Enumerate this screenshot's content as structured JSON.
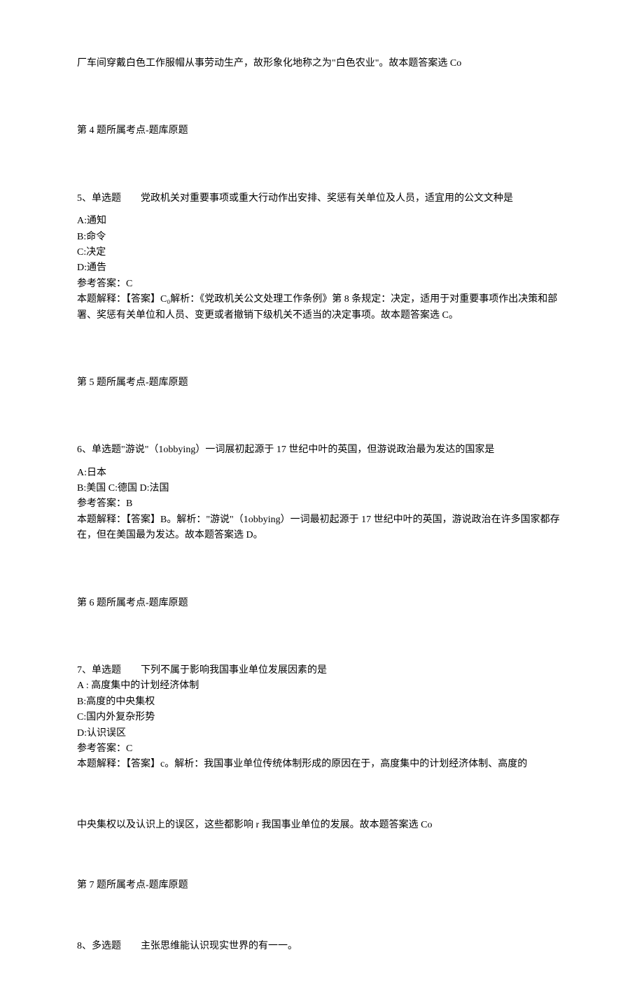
{
  "intro_fragment": "厂车间穿戴白色工作服帽从事劳动生产，故形象化地称之为\"白色农业\"。故本题答案选 Co",
  "q4": {
    "note": "第 4 题所属考点-题库原题"
  },
  "q5": {
    "stem": "5、单选题　　党政机关对重要事项或重大行动作出安排、奖惩有关单位及人员，适宜用的公文文种是",
    "optA": "A:通知",
    "optB": "B:命令",
    "optC": "C:决定",
    "optD": "D:通告",
    "answer": "参考答案：C",
    "explain": "本题解释：【答案】C₀解析：《党政机关公文处理工作条例》第 8 条规定：决定，适用于对重要事项作出决策和部署、奖惩有关单位和人员、变更或者撤销下级机关不适当的决定事项。故本题答案选 C。",
    "note": "第 5 题所属考点-题库原题"
  },
  "q6": {
    "stem": "6、单选题\"游说\"（1obbying）一词展初起源于 17 世纪中叶的英国，但游说政治最为发达的国家是",
    "optA": "A:日本",
    "optBCD": "B:美国 C:德国 D:法国",
    "answer": "参考答案：B",
    "explain": "本题解释：【答案】B。解析：\"游说\"（1obbying）一词最初起源于 17 世纪中叶的英国，游说政治在许多国家都存在，但在美国最为发达。故本题答案选 D。",
    "note": "第 6 题所属考点-题库原题"
  },
  "q7": {
    "stem": "7、单选题　　下列不属于影响我国事业单位发展因素的是",
    "optA": "A : 高度集中的计划经济体制",
    "optB": "B:高度的中央集权",
    "optC": "C:国内外复杂形势",
    "optD": "D:认识误区",
    "answer": "参考答案：C",
    "explain": "本题解释：【答案】c。解析：我国事业单位传统体制形成的原因在于，高度集中的计划经济体制、高度的",
    "explain2": "中央集权以及认识上的误区，这些都影响 r 我国事业单位的发展。故本题答案选 Co",
    "note": "第 7 题所属考点-题库原题"
  },
  "q8": {
    "stem": "8、多选题　　主张思维能认识现实世界的有一一。"
  }
}
